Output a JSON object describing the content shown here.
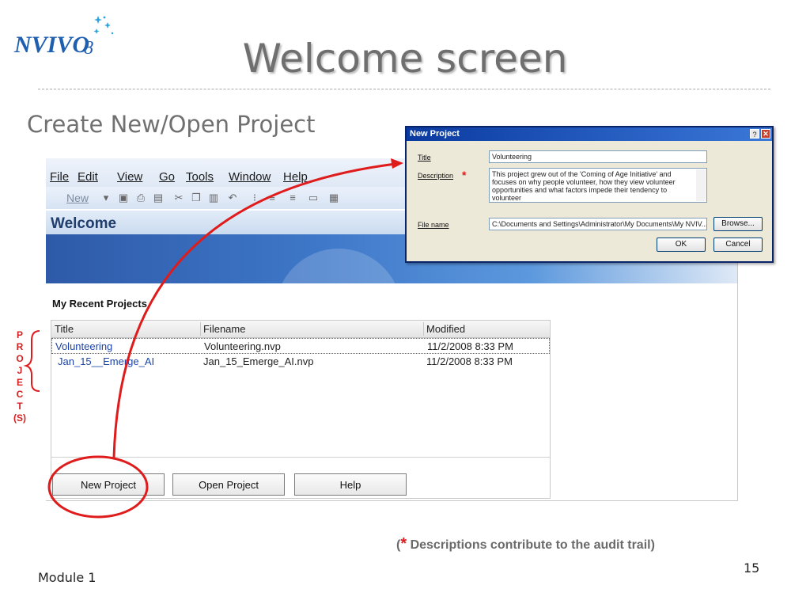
{
  "logo": {
    "text": "NVIVO",
    "version": "8"
  },
  "slide": {
    "title": "Welcome screen",
    "subtitle": "Create New/Open Project",
    "footer_left": "Module 1",
    "page_number": "15",
    "footnote_star": "*",
    "footnote_text": " Descriptions contribute to the audit trail)",
    "footnote_open": "(",
    "side_letters": [
      "P",
      "R",
      "O",
      "J",
      "E",
      "C",
      "T",
      "(S)"
    ]
  },
  "app": {
    "menu": [
      "File",
      "Edit",
      "View",
      "Go",
      "Tools",
      "Window",
      "Help"
    ],
    "toolbar_new": "New",
    "welcome_title": "Welcome",
    "recent_label": "My Recent Projects",
    "columns": [
      "Title",
      "Filename",
      "Modified"
    ],
    "projects": [
      {
        "title": "Volunteering",
        "filename": "Volunteering.nvp",
        "modified": "11/2/2008 8:33 PM"
      },
      {
        "title": "Jan_15__Emerge_AI",
        "filename": "Jan_15_Emerge_AI.nvp",
        "modified": "11/2/2008 8:33 PM"
      }
    ],
    "buttons": {
      "new_project": "New Project",
      "open_project": "Open Project",
      "help": "Help"
    }
  },
  "dialog": {
    "title": "New Project",
    "title_label": "Title",
    "title_value": "Volunteering",
    "description_label": "Description",
    "description_value": "This project grew out of the 'Coming of Age Initiative' and focuses on why people volunteer, how they view volunteer opportunities and what factors impede their tendency to volunteer",
    "filename_label": "File name",
    "filename_value": "C:\\Documents and Settings\\Administrator\\My Documents\\My NVIV...",
    "browse_label": "Browse...",
    "ok_label": "OK",
    "cancel_label": "Cancel",
    "help_glyph": "?",
    "close_glyph": "✕",
    "required_mark": "*"
  },
  "colors": {
    "annotation_red": "#e01b1b",
    "link_blue": "#1c44a8",
    "title_gray": "#6f6f6f"
  }
}
